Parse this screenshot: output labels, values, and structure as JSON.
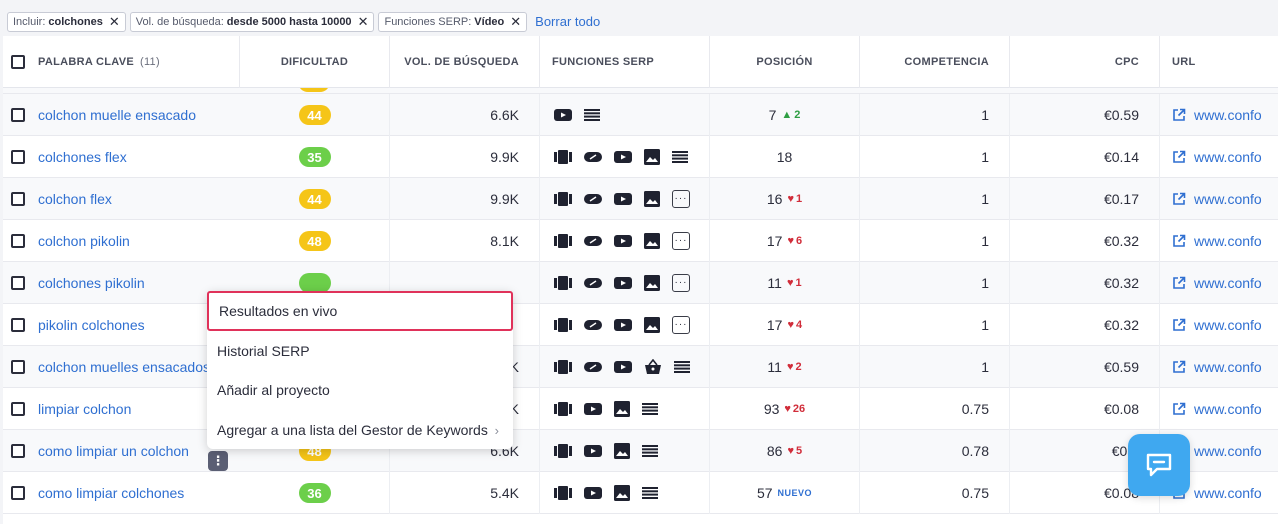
{
  "filters": [
    {
      "label": "Incluir:",
      "value": "colchones"
    },
    {
      "label": "Vol. de búsqueda:",
      "value": "desde 5000 hasta 10000"
    },
    {
      "label": "Funciones SERP:",
      "value": "Vídeo"
    }
  ],
  "clear_all": "Borrar todo",
  "headers": {
    "keyword": "PALABRA CLAVE",
    "keyword_count": "(11)",
    "difficulty": "DIFICULTAD",
    "volume": "VOL. DE BÚSQUEDA",
    "serp": "FUNCIONES SERP",
    "position": "POSICIÓN",
    "competition": "COMPETENCIA",
    "cpc": "CPC",
    "url": "URL"
  },
  "colors": {
    "yellow": "#f5c518",
    "green": "#6ccf4a",
    "accent": "#2f6fd1",
    "highlight": "#e0325a"
  },
  "rows": [
    {
      "keyword": "colchon muelle ensacado",
      "difficulty": "44",
      "diff_color": "yellow",
      "volume": "6.6K",
      "serp": [
        "youtube-icon",
        "list-icon"
      ],
      "position": "7",
      "change": "2",
      "change_dir": "up",
      "competition": "1",
      "cpc": "€0.59",
      "url": "www.confo"
    },
    {
      "keyword": "colchones flex",
      "difficulty": "35",
      "diff_color": "green",
      "volume": "9.9K",
      "serp": [
        "carousel-icon",
        "link-icon",
        "youtube-icon",
        "image-icon",
        "list-icon"
      ],
      "position": "18",
      "change": "",
      "change_dir": "",
      "competition": "1",
      "cpc": "€0.14",
      "url": "www.confo"
    },
    {
      "keyword": "colchon flex",
      "difficulty": "44",
      "diff_color": "yellow",
      "volume": "9.9K",
      "serp": [
        "carousel-icon",
        "link-icon",
        "youtube-icon",
        "image-icon",
        "more-icon"
      ],
      "position": "16",
      "change": "1",
      "change_dir": "down",
      "competition": "1",
      "cpc": "€0.17",
      "url": "www.confo"
    },
    {
      "keyword": "colchon pikolin",
      "difficulty": "48",
      "diff_color": "yellow",
      "volume": "8.1K",
      "serp": [
        "carousel-icon",
        "link-icon",
        "youtube-icon",
        "image-icon",
        "more-icon"
      ],
      "position": "17",
      "change": "6",
      "change_dir": "down",
      "competition": "1",
      "cpc": "€0.32",
      "url": "www.confo"
    },
    {
      "keyword": "colchones pikolin",
      "difficulty": "",
      "diff_color": "green",
      "volume": "",
      "serp": [
        "carousel-icon",
        "link-icon",
        "youtube-icon",
        "image-icon",
        "more-icon"
      ],
      "position": "11",
      "change": "1",
      "change_dir": "down",
      "competition": "1",
      "cpc": "€0.32",
      "url": "www.confo"
    },
    {
      "keyword": "pikolin colchones",
      "difficulty": "",
      "diff_color": "",
      "volume": "",
      "serp": [
        "carousel-icon",
        "link-icon",
        "youtube-icon",
        "image-icon",
        "more-icon"
      ],
      "position": "17",
      "change": "4",
      "change_dir": "down",
      "competition": "1",
      "cpc": "€0.32",
      "url": "www.confo"
    },
    {
      "keyword": "colchon muelles ensacados",
      "difficulty": "",
      "diff_color": "",
      "volume": "K",
      "serp": [
        "carousel-icon",
        "link-icon",
        "youtube-icon",
        "shop-icon",
        "list-icon"
      ],
      "position": "11",
      "change": "2",
      "change_dir": "down",
      "competition": "1",
      "cpc": "€0.59",
      "url": "www.confo"
    },
    {
      "keyword": "limpiar colchon",
      "difficulty": "",
      "diff_color": "",
      "volume": "K",
      "serp": [
        "carousel-icon",
        "youtube-icon",
        "image-icon",
        "list-icon"
      ],
      "position": "93",
      "change": "26",
      "change_dir": "down",
      "competition": "0.75",
      "cpc": "€0.08",
      "url": "www.confo"
    },
    {
      "keyword": "como limpiar un colchon",
      "difficulty": "48",
      "diff_color": "yellow",
      "volume": "6.6K",
      "serp": [
        "carousel-icon",
        "youtube-icon",
        "image-icon",
        "list-icon"
      ],
      "position": "86",
      "change": "5",
      "change_dir": "down",
      "competition": "0.78",
      "cpc": "€0.0",
      "url": "www.confo"
    },
    {
      "keyword": "como limpiar colchones",
      "difficulty": "36",
      "diff_color": "green",
      "volume": "5.4K",
      "serp": [
        "carousel-icon",
        "youtube-icon",
        "image-icon",
        "list-icon"
      ],
      "position": "57",
      "change": "NUEVO",
      "change_dir": "new",
      "competition": "0.75",
      "cpc": "€0.08",
      "url": "www.confo"
    }
  ],
  "context_menu": {
    "items": [
      "Resultados en vivo",
      "Historial SERP",
      "Añadir al proyecto",
      "Agregar a una lista del Gestor de Keywords"
    ]
  }
}
